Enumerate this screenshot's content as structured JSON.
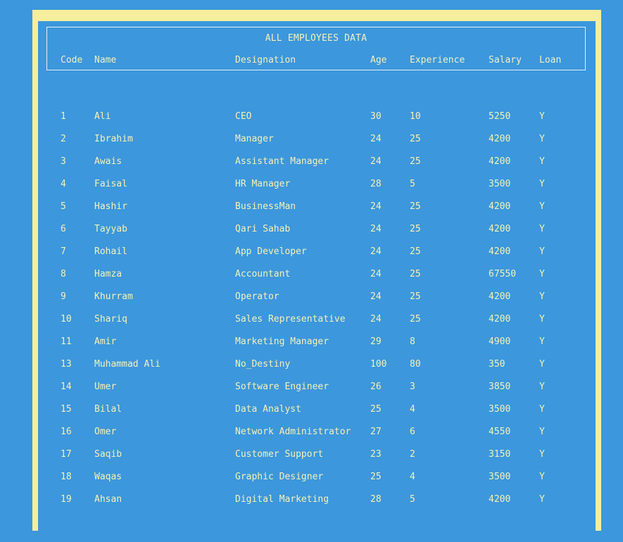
{
  "title": "ALL EMPLOYEES DATA",
  "columns": {
    "code": "Code",
    "name": "Name",
    "designation": "Designation",
    "age": "Age",
    "experience": "Experience",
    "salary": "Salary",
    "loan": "Loan"
  },
  "rows": [
    {
      "code": "1",
      "name": "Ali",
      "designation": "CEO",
      "age": "30",
      "experience": "10",
      "salary": "5250",
      "loan": "Y"
    },
    {
      "code": "2",
      "name": "Ibrahim",
      "designation": "Manager",
      "age": "24",
      "experience": "25",
      "salary": "4200",
      "loan": "Y"
    },
    {
      "code": "3",
      "name": "Awais",
      "designation": "Assistant Manager",
      "age": "24",
      "experience": "25",
      "salary": "4200",
      "loan": "Y"
    },
    {
      "code": "4",
      "name": "Faisal",
      "designation": "HR Manager",
      "age": "28",
      "experience": "5",
      "salary": "3500",
      "loan": "Y"
    },
    {
      "code": "5",
      "name": "Hashir",
      "designation": "BusinessMan",
      "age": "24",
      "experience": "25",
      "salary": "4200",
      "loan": "Y"
    },
    {
      "code": "6",
      "name": "Tayyab",
      "designation": "Qari Sahab",
      "age": "24",
      "experience": "25",
      "salary": "4200",
      "loan": "Y"
    },
    {
      "code": "7",
      "name": "Rohail",
      "designation": "App Developer",
      "age": "24",
      "experience": "25",
      "salary": "4200",
      "loan": "Y"
    },
    {
      "code": "8",
      "name": "Hamza",
      "designation": "Accountant",
      "age": "24",
      "experience": "25",
      "salary": "67550",
      "loan": "Y"
    },
    {
      "code": "9",
      "name": "Khurram",
      "designation": "Operator",
      "age": "24",
      "experience": "25",
      "salary": "4200",
      "loan": "Y"
    },
    {
      "code": "10",
      "name": "Shariq",
      "designation": "Sales Representative",
      "age": "24",
      "experience": "25",
      "salary": "4200",
      "loan": "Y"
    },
    {
      "code": "11",
      "name": "Amir",
      "designation": "Marketing Manager",
      "age": "29",
      "experience": "8",
      "salary": "4900",
      "loan": "Y"
    },
    {
      "code": "13",
      "name": "Muhammad Ali",
      "designation": "No_Destiny",
      "age": "100",
      "experience": "80",
      "salary": "350",
      "loan": "Y"
    },
    {
      "code": "14",
      "name": "Umer",
      "designation": "Software Engineer",
      "age": "26",
      "experience": "3",
      "salary": "3850",
      "loan": "Y"
    },
    {
      "code": "15",
      "name": "Bilal",
      "designation": "Data Analyst",
      "age": "25",
      "experience": "4",
      "salary": "3500",
      "loan": "Y"
    },
    {
      "code": "16",
      "name": "Omer",
      "designation": "Network Administrator",
      "age": "27",
      "experience": "6",
      "salary": "4550",
      "loan": "Y"
    },
    {
      "code": "17",
      "name": "Saqib",
      "designation": "Customer Support",
      "age": "23",
      "experience": "2",
      "salary": "3150",
      "loan": "Y"
    },
    {
      "code": "18",
      "name": "Waqas",
      "designation": "Graphic Designer",
      "age": "25",
      "experience": "4",
      "salary": "3500",
      "loan": "Y"
    },
    {
      "code": "19",
      "name": "Ahsan",
      "designation": "Digital Marketing",
      "age": "28",
      "experience": "5",
      "salary": "4200",
      "loan": "Y"
    }
  ]
}
